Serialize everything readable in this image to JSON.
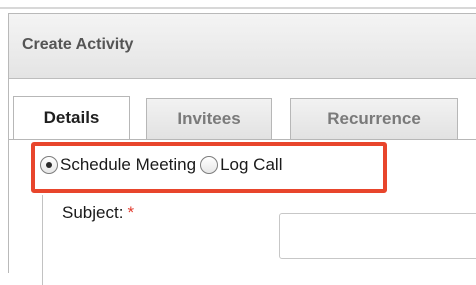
{
  "dialog": {
    "title": "Create Activity"
  },
  "tabs": [
    {
      "label": "Details",
      "active": true
    },
    {
      "label": "Invitees",
      "active": false
    },
    {
      "label": "Recurrence",
      "active": false
    }
  ],
  "activity_type": {
    "options": [
      {
        "label": "Schedule Meeting",
        "checked": true
      },
      {
        "label": "Log Call",
        "checked": false
      }
    ]
  },
  "form": {
    "subject_label": "Subject:",
    "required_marker": "*",
    "subject_value": ""
  },
  "colors": {
    "highlight": "#e8452c",
    "required": "#e23b2e"
  }
}
